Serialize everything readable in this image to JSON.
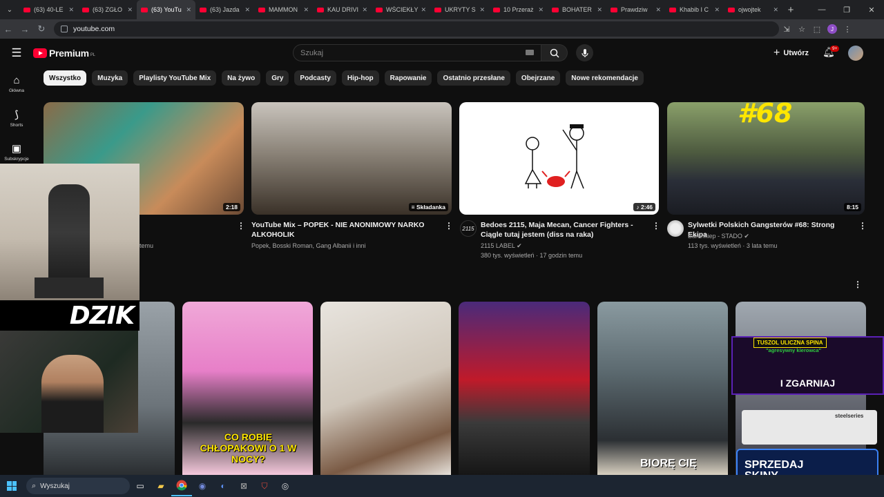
{
  "browser": {
    "tabs": [
      {
        "label": "(63) 40-LE"
      },
      {
        "label": "(63) ZGŁO"
      },
      {
        "label": "(63) YouTu"
      },
      {
        "label": "(63) Jazda"
      },
      {
        "label": "MAMMON"
      },
      {
        "label": "KAU DRIVI"
      },
      {
        "label": "WŚCIEKŁY"
      },
      {
        "label": "UKRYTY S"
      },
      {
        "label": "10 Przeraż"
      },
      {
        "label": "BOHATER"
      },
      {
        "label": "Prawdziw"
      },
      {
        "label": "Khabib I C"
      },
      {
        "label": "ojwojtek"
      }
    ],
    "active_tab_index": 2,
    "url": "youtube.com",
    "profile_initial": "J"
  },
  "youtube": {
    "logo_text": "Premium",
    "logo_region": "PL",
    "search_placeholder": "Szukaj",
    "create_label": "Utwórz",
    "notification_count": "9+",
    "rail": [
      {
        "label": "Główna",
        "icon": "home-icon"
      },
      {
        "label": "Shorts",
        "icon": "shorts-icon"
      },
      {
        "label": "Subskrypcje",
        "icon": "subscriptions-icon"
      }
    ],
    "chips": [
      "Wszystko",
      "Muzyka",
      "Playlisty YouTube Mix",
      "Na żywo",
      "Gry",
      "Podcasty",
      "Hip-hop",
      "Rapowanie",
      "Ostatnio przesłane",
      "Obejrzane",
      "Nowe rekomendacje"
    ],
    "videos": [
      {
        "duration": "2:18",
        "meta_partial": "temu"
      },
      {
        "badge": "Składanka",
        "title": "YouTube Mix – POPEK - NIE ANONIMOWY NARKO ALKOHOLIK",
        "channel": "Popek, Bosski Roman, Gang Albanii i inni"
      },
      {
        "duration": "2:46",
        "title": "Bedoes 2115, Maja Mecan, Cancer Fighters - Ciągle tutaj jestem (diss na raka)",
        "channel": "2115 LABEL",
        "stats": "380 tys. wyświetleń · 17 godzin temu",
        "avatar_text": "2115"
      },
      {
        "duration": "8:15",
        "title": "Sylwetki Polskich Gangsterów #68: Strong Ekipa",
        "channel": "Barankiep - STADO",
        "stats": "113 tys. wyświetleń · 3 lata temu",
        "thumb_text": "#68"
      }
    ],
    "shorts_text": {
      "short1": "CO ROBIĘ CHŁOPAKOWI O 1 W NOCY?",
      "short5": "BIORĘ CIĘ"
    }
  },
  "overlays": {
    "brand": "DZIK",
    "ad_lines": [
      "TUSZOL ULICZNA SPINA",
      "\"agresywny kierowca\"",
      "I ZGARNIAJ"
    ],
    "ad_steel": "steelseries",
    "ad_bottom": "SPRZEDAJ SKINY"
  },
  "taskbar": {
    "search_label": "Wyszukaj"
  }
}
